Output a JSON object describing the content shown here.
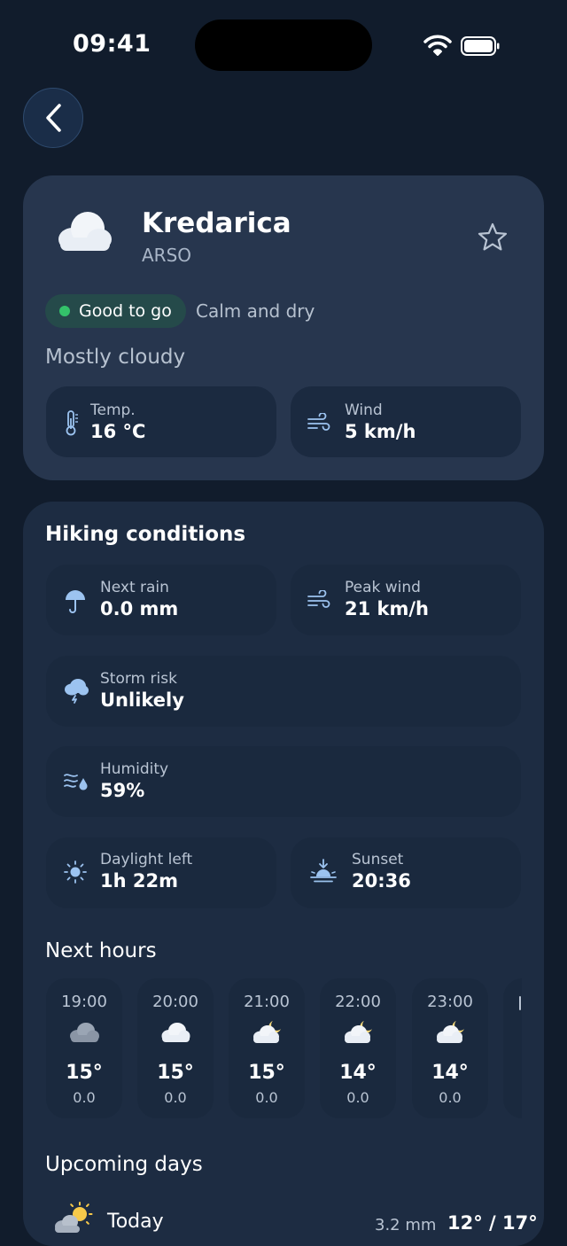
{
  "status_bar": {
    "time": "09:41"
  },
  "location": {
    "name": "Kredarica",
    "source": "ARSO",
    "badge": "Good to go",
    "badge_note": "Calm and dry",
    "condition": "Mostly cloudy",
    "temp_label": "Temp.",
    "temp_value": "16 °C",
    "wind_label": "Wind",
    "wind_value": "5 km/h"
  },
  "hiking": {
    "title": "Hiking conditions",
    "next_rain_label": "Next rain",
    "next_rain_value": "0.0 mm",
    "peak_wind_label": "Peak wind",
    "peak_wind_value": "21 km/h",
    "storm_label": "Storm risk",
    "storm_value": "Unlikely",
    "humidity_label": "Humidity",
    "humidity_value": "59%",
    "daylight_label": "Daylight left",
    "daylight_value": "1h 22m",
    "sunset_label": "Sunset",
    "sunset_value": "20:36"
  },
  "next_hours": {
    "title": "Next hours",
    "hours": [
      {
        "time": "19:00",
        "temp": "15°",
        "rain": "0.0",
        "icon": "cloud-icon"
      },
      {
        "time": "20:00",
        "temp": "15°",
        "rain": "0.0",
        "icon": "cloud-icon"
      },
      {
        "time": "21:00",
        "temp": "15°",
        "rain": "0.0",
        "icon": "cloud-moon-icon"
      },
      {
        "time": "22:00",
        "temp": "14°",
        "rain": "0.0",
        "icon": "cloud-moon-icon"
      },
      {
        "time": "23:00",
        "temp": "14°",
        "rain": "0.0",
        "icon": "cloud-moon-icon"
      }
    ]
  },
  "upcoming": {
    "title": "Upcoming days",
    "days": [
      {
        "day": "Today",
        "rain": "3.2 mm",
        "range": "12° / 17°"
      }
    ]
  },
  "colors": {
    "accent_green": "#34c26a",
    "icon_blue": "#9cc3f0",
    "card": "#27364e"
  }
}
